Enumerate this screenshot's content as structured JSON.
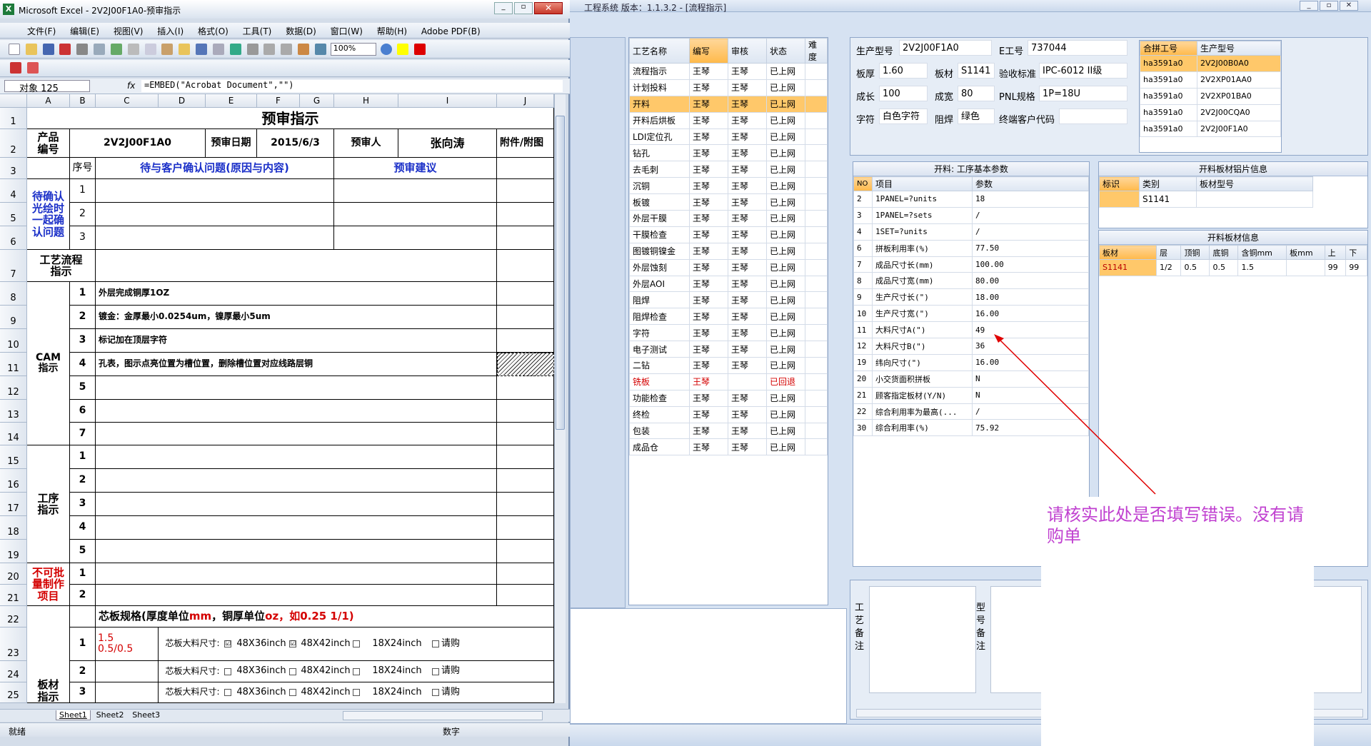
{
  "excel": {
    "title": "Microsoft Excel - 2V2J00F1A0-预审指示",
    "menu": [
      "文件(F)",
      "编辑(E)",
      "视图(V)",
      "插入(I)",
      "格式(O)",
      "工具(T)",
      "数据(D)",
      "窗口(W)",
      "帮助(H)",
      "Adobe PDF(B)"
    ],
    "zoom": "100%",
    "name_box": "对象 125",
    "fx": "fx",
    "formula": "=EMBED(\"Acrobat Document\",\"\")",
    "columns": [
      "A",
      "B",
      "C",
      "D",
      "E",
      "F",
      "G",
      "H",
      "I",
      "J"
    ],
    "rows": [
      "1",
      "2",
      "3",
      "4",
      "5",
      "6",
      "7",
      "8",
      "9",
      "10",
      "11",
      "12",
      "13",
      "14",
      "15",
      "16",
      "17",
      "18",
      "19",
      "20",
      "21",
      "22",
      "23",
      "24",
      "25"
    ],
    "sheet_title": "预审指示",
    "product_no_label": "产品\n编号",
    "product_no": "2V2J00F1A0",
    "review_date_label": "预审日期",
    "review_date": "2015/6/3",
    "reviewer_label": "预审人",
    "reviewer": "张向涛",
    "attachment_label": "附件/附图",
    "seq_label": "序号",
    "customer_issue_label": "待与客户确认问题(原因与内容)",
    "review_suggest_label": "预审建议",
    "confirm_label": "待确认\n光绘时\n一起确\n认问题",
    "confirm_nums": [
      "1",
      "2",
      "3"
    ],
    "process_flow_label": "工艺流程\n指示",
    "cam_label": "CAM\n指示",
    "cam_items": [
      {
        "n": "1",
        "t": "外层完成铜厚1OZ"
      },
      {
        "n": "2",
        "t": "镀金：金厚最小0.0254um，镍厚最小5um"
      },
      {
        "n": "3",
        "t": "标记加在顶层字符"
      },
      {
        "n": "4",
        "t": "孔表，图示点亮位置为槽位置，删除槽位置对应线路层铜"
      },
      {
        "n": "5",
        "t": ""
      },
      {
        "n": "6",
        "t": ""
      },
      {
        "n": "7",
        "t": ""
      }
    ],
    "process_label": "工序\n指示",
    "process_nums": [
      "1",
      "2",
      "3",
      "4",
      "5"
    ],
    "notbatch_label": "不可批\n量制作\n项目",
    "notbatch_nums": [
      "1",
      "2"
    ],
    "core_spec_a": "芯板规格(厚度单位",
    "core_spec_mm": "mm",
    "core_spec_b": "，铜厚单位",
    "core_spec_oz": "oz",
    "core_spec_c": "，如0.25 1/1)",
    "board_label": "板材\n指示",
    "core_rows": [
      {
        "n": "1",
        "spec": "1.5\n0.5/0.5",
        "label": "芯板大料尺寸:",
        "o1": "48X36inch",
        "o2": "48X42inch",
        "o3": "18X24inch",
        "o4": "请购",
        "c1": "☑",
        "c2": "☑"
      },
      {
        "n": "2",
        "spec": "",
        "label": "芯板大料尺寸:",
        "o1": "48X36inch",
        "o2": "48X42inch",
        "o3": "18X24inch",
        "o4": "请购",
        "c1": "",
        "c2": ""
      },
      {
        "n": "3",
        "spec": "",
        "label": "芯板大料尺寸:",
        "o1": "48X36inch",
        "o2": "48X42inch",
        "o3": "18X24inch",
        "o4": "请购",
        "c1": "",
        "c2": ""
      }
    ],
    "sheets": [
      "Sheet1",
      "Sheet2",
      "Sheet3"
    ],
    "status": "就绪",
    "status_num": "数字"
  },
  "app": {
    "title": "工程系统  版本：1.1.3.2 - [流程指示]",
    "flow_headers": [
      "工艺名称",
      "编写",
      "审核",
      "状态",
      "难度"
    ],
    "flow_rows": [
      [
        "流程指示",
        "王琴",
        "王琴",
        "已上网",
        ""
      ],
      [
        "计划投料",
        "王琴",
        "王琴",
        "已上网",
        ""
      ],
      [
        "开料",
        "王琴",
        "王琴",
        "已上网",
        ""
      ],
      [
        "开料后烘板",
        "王琴",
        "王琴",
        "已上网",
        ""
      ],
      [
        "LDI定位孔",
        "王琴",
        "王琴",
        "已上网",
        ""
      ],
      [
        "钻孔",
        "王琴",
        "王琴",
        "已上网",
        ""
      ],
      [
        "去毛刺",
        "王琴",
        "王琴",
        "已上网",
        ""
      ],
      [
        "沉铜",
        "王琴",
        "王琴",
        "已上网",
        ""
      ],
      [
        "板镀",
        "王琴",
        "王琴",
        "已上网",
        ""
      ],
      [
        "外层干膜",
        "王琴",
        "王琴",
        "已上网",
        ""
      ],
      [
        "干膜检查",
        "王琴",
        "王琴",
        "已上网",
        ""
      ],
      [
        "图镀铜镍金",
        "王琴",
        "王琴",
        "已上网",
        ""
      ],
      [
        "外层蚀刻",
        "王琴",
        "王琴",
        "已上网",
        ""
      ],
      [
        "外层AOI",
        "王琴",
        "王琴",
        "已上网",
        ""
      ],
      [
        "阻焊",
        "王琴",
        "王琴",
        "已上网",
        ""
      ],
      [
        "阻焊检查",
        "王琴",
        "王琴",
        "已上网",
        ""
      ],
      [
        "字符",
        "王琴",
        "王琴",
        "已上网",
        ""
      ],
      [
        "电子测试",
        "王琴",
        "王琴",
        "已上网",
        ""
      ],
      [
        "二钻",
        "王琴",
        "王琴",
        "已上网",
        ""
      ],
      [
        "铣板",
        "王琴",
        "",
        "已回退",
        ""
      ],
      [
        "功能检查",
        "王琴",
        "王琴",
        "已上网",
        ""
      ],
      [
        "终检",
        "王琴",
        "王琴",
        "已上网",
        ""
      ],
      [
        "包装",
        "王琴",
        "王琴",
        "已上网",
        ""
      ],
      [
        "成品仓",
        "王琴",
        "王琴",
        "已上网",
        ""
      ]
    ],
    "info": {
      "model_label": "生产型号",
      "model": "2V2J00F1A0",
      "e_label": "E工号",
      "e": "737044",
      "thick_label": "板厚",
      "thick": "1.60",
      "mat_label": "板材",
      "mat": "S1141",
      "std_label": "验收标准",
      "std": "IPC-6012 II级",
      "len_label": "成长",
      "len": "100",
      "wid_label": "成宽",
      "wid": "80",
      "pnl_label": "PNL规格",
      "pnl": "1P=18U",
      "char_label": "字符",
      "char": "白色字符",
      "mask_label": "阻焊",
      "mask": "绿色",
      "cust_label": "终端客户代码",
      "cust": ""
    },
    "merge_headers": [
      "合拼工号",
      "生产型号"
    ],
    "merge_rows": [
      [
        "ha3591a0",
        "2V2J00B0A0"
      ],
      [
        "ha3591a0",
        "2V2XP01AA0"
      ],
      [
        "ha3591a0",
        "2V2XP01BA0"
      ],
      [
        "ha3591a0",
        "2V2J00CQA0"
      ],
      [
        "ha3591a0",
        "2V2J00F1A0"
      ]
    ],
    "param_title": "开料: 工序基本参数",
    "param_headers": [
      "NO",
      "项目",
      "参数"
    ],
    "param_rows": [
      [
        "2",
        "1PANEL=?units",
        "18"
      ],
      [
        "3",
        "1PANEL=?sets",
        "/"
      ],
      [
        "4",
        "1SET=?units",
        "/"
      ],
      [
        "6",
        "拼板利用率(%)",
        "77.50"
      ],
      [
        "7",
        "成品尺寸长(mm)",
        "100.00"
      ],
      [
        "8",
        "成品尺寸宽(mm)",
        "80.00"
      ],
      [
        "9",
        "生产尺寸长(\")",
        "18.00"
      ],
      [
        "10",
        "生产尺寸宽(\")",
        "16.00"
      ],
      [
        "11",
        "大料尺寸A(\")",
        "49"
      ],
      [
        "12",
        "大料尺寸B(\")",
        "36"
      ],
      [
        "19",
        "纬向尺寸(\")",
        "16.00"
      ],
      [
        "20",
        "小交货面积拼板",
        "N"
      ],
      [
        "21",
        "顾客指定板材(Y/N)",
        "N"
      ],
      [
        "22",
        "综合利用率为最高(...",
        "/"
      ],
      [
        "30",
        "综合利用率(%)",
        "75.92"
      ]
    ],
    "cut_img_title": "开料板材铝片信息",
    "cut_img_headers": [
      "标识",
      "类别",
      "板材型号"
    ],
    "cut_img_rows": [
      [
        "",
        "S1141",
        ""
      ]
    ],
    "cut_info_title": "开料板材信息",
    "cut_info_headers": [
      "板材",
      "层",
      "顶铜",
      "底铜",
      "含铜mm",
      "板mm",
      "上",
      "下"
    ],
    "cut_info_rows": [
      [
        "S1141",
        "1/2",
        "0.5",
        "0.5",
        "1.5",
        "",
        "99",
        "99"
      ]
    ],
    "note_craft": "工\n艺\n备\n注",
    "note_model": "型\n号\n备\n注",
    "annotation": "请核实此处是否填写错误。没有请购单"
  }
}
